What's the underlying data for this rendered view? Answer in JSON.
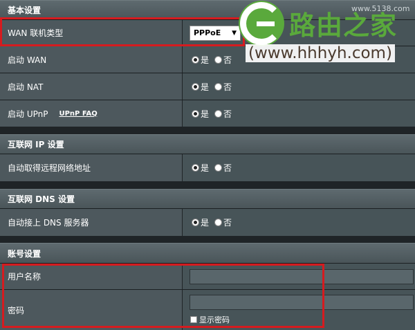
{
  "basic": {
    "header": "基本设置",
    "wan_type_label": "WAN 联机类型",
    "wan_type_value": "PPPoE",
    "enable_wan_label": "启动 WAN",
    "enable_nat_label": "启动 NAT",
    "enable_upnp_label": "启动 UPnP",
    "upnp_faq": "UPnP  FAQ"
  },
  "internet_ip": {
    "header": "互联网 IP 设置",
    "auto_ip_label": "自动取得远程网络地址"
  },
  "internet_dns": {
    "header": "互联网 DNS 设置",
    "auto_dns_label": "自动接上 DNS 服务器"
  },
  "account": {
    "header": "账号设置",
    "username_label": "用户名称",
    "username_value": "",
    "password_label": "密码",
    "password_value": "",
    "show_password_label": "显示密码"
  },
  "radio": {
    "yes": "是",
    "no": "否"
  },
  "watermark": {
    "brand": "路由之家",
    "url": "(www.hhhyh.com)",
    "faint": "www.5138.com"
  },
  "colors": {
    "highlight": "#d61b1f",
    "brand_green": "#5aa93c"
  }
}
